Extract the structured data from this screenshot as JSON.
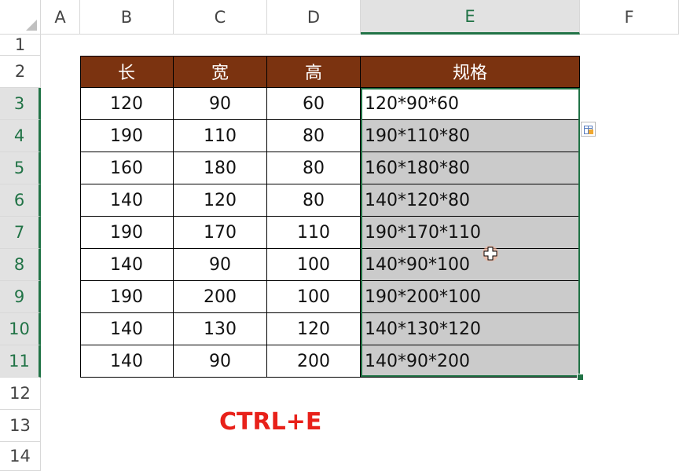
{
  "columns": [
    "A",
    "B",
    "C",
    "D",
    "E",
    "F"
  ],
  "rows": [
    "1",
    "2",
    "3",
    "4",
    "5",
    "6",
    "7",
    "8",
    "9",
    "10",
    "11",
    "12",
    "13",
    "14"
  ],
  "selected_column": "E",
  "selected_rows": [
    "3",
    "4",
    "5",
    "6",
    "7",
    "8",
    "9",
    "10",
    "11"
  ],
  "table": {
    "headers": [
      "长",
      "宽",
      "高",
      "规格"
    ],
    "rows": [
      [
        "120",
        "90",
        "60",
        "120*90*60"
      ],
      [
        "190",
        "110",
        "80",
        "190*110*80"
      ],
      [
        "160",
        "180",
        "80",
        "160*180*80"
      ],
      [
        "140",
        "120",
        "80",
        "140*120*80"
      ],
      [
        "190",
        "170",
        "110",
        "190*170*110"
      ],
      [
        "140",
        "90",
        "100",
        "140*90*100"
      ],
      [
        "190",
        "200",
        "100",
        "190*200*100"
      ],
      [
        "140",
        "130",
        "120",
        "140*130*120"
      ],
      [
        "140",
        "90",
        "200",
        "140*90*200"
      ]
    ]
  },
  "caption": "CTRL+E",
  "icons": {
    "flash_fill": "flash-fill-options-icon",
    "cursor": "cell-select-cursor-icon"
  },
  "colors": {
    "header_fill": "#7b3310",
    "header_text": "#ffffff",
    "selection": "#217346",
    "filled_cells": "#cbcbcb",
    "caption": "#e8211a"
  }
}
